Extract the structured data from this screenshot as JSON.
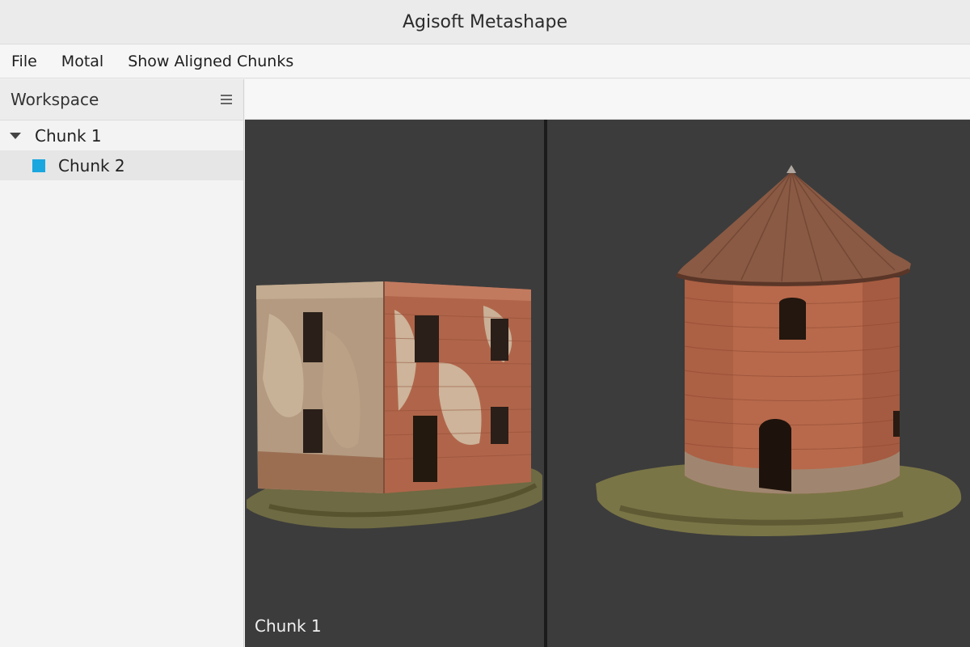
{
  "window": {
    "title": "Agisoft Metashape"
  },
  "menu": {
    "items": [
      "File",
      "Motal",
      "Show Aligned Chunks"
    ]
  },
  "workspace": {
    "title": "Workspace",
    "menu_icon": "hamburger-menu-icon",
    "tree": [
      {
        "label": "Chunk 1",
        "expanded": true,
        "icon": "caret-down-icon"
      },
      {
        "label": "Chunk 2",
        "selected": true,
        "color": "#1aa7e0"
      }
    ]
  },
  "viewports": {
    "left": {
      "label": "Chunk 1"
    },
    "right": {
      "label": ""
    }
  },
  "colors": {
    "viewport_bg": "#3c3c3c",
    "divider": "#1b1b1b",
    "chunk2_swatch": "#1aa7e0"
  }
}
